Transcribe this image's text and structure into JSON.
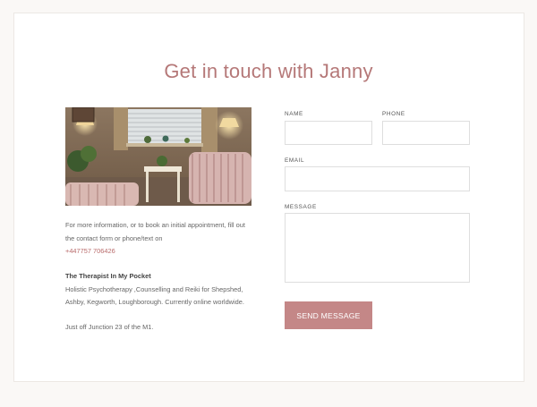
{
  "page": {
    "title": "Get in touch with Janny"
  },
  "sidebar": {
    "intro_text": "For more information, or to book an initial appointment, fill out the contact form or phone/text on",
    "phone": "+447757 706426",
    "business_name": "The Therapist In My Pocket",
    "business_description": "Holistic Psychotherapy ,Counselling and Reiki for Shepshed, Ashby, Kegworth, Loughborough. Currently online worldwide.",
    "location_note": "Just off Junction 23 of the M1."
  },
  "form": {
    "name_label": "NAME",
    "name_value": "",
    "phone_label": "PHONE",
    "phone_value": "",
    "email_label": "EMAIL",
    "email_value": "",
    "message_label": "MESSAGE",
    "message_value": "",
    "submit_label": "SEND MESSAGE"
  },
  "colors": {
    "accent": "#b57878",
    "button": "#c48787",
    "link": "#b86a6a",
    "background": "#faf8f6"
  }
}
